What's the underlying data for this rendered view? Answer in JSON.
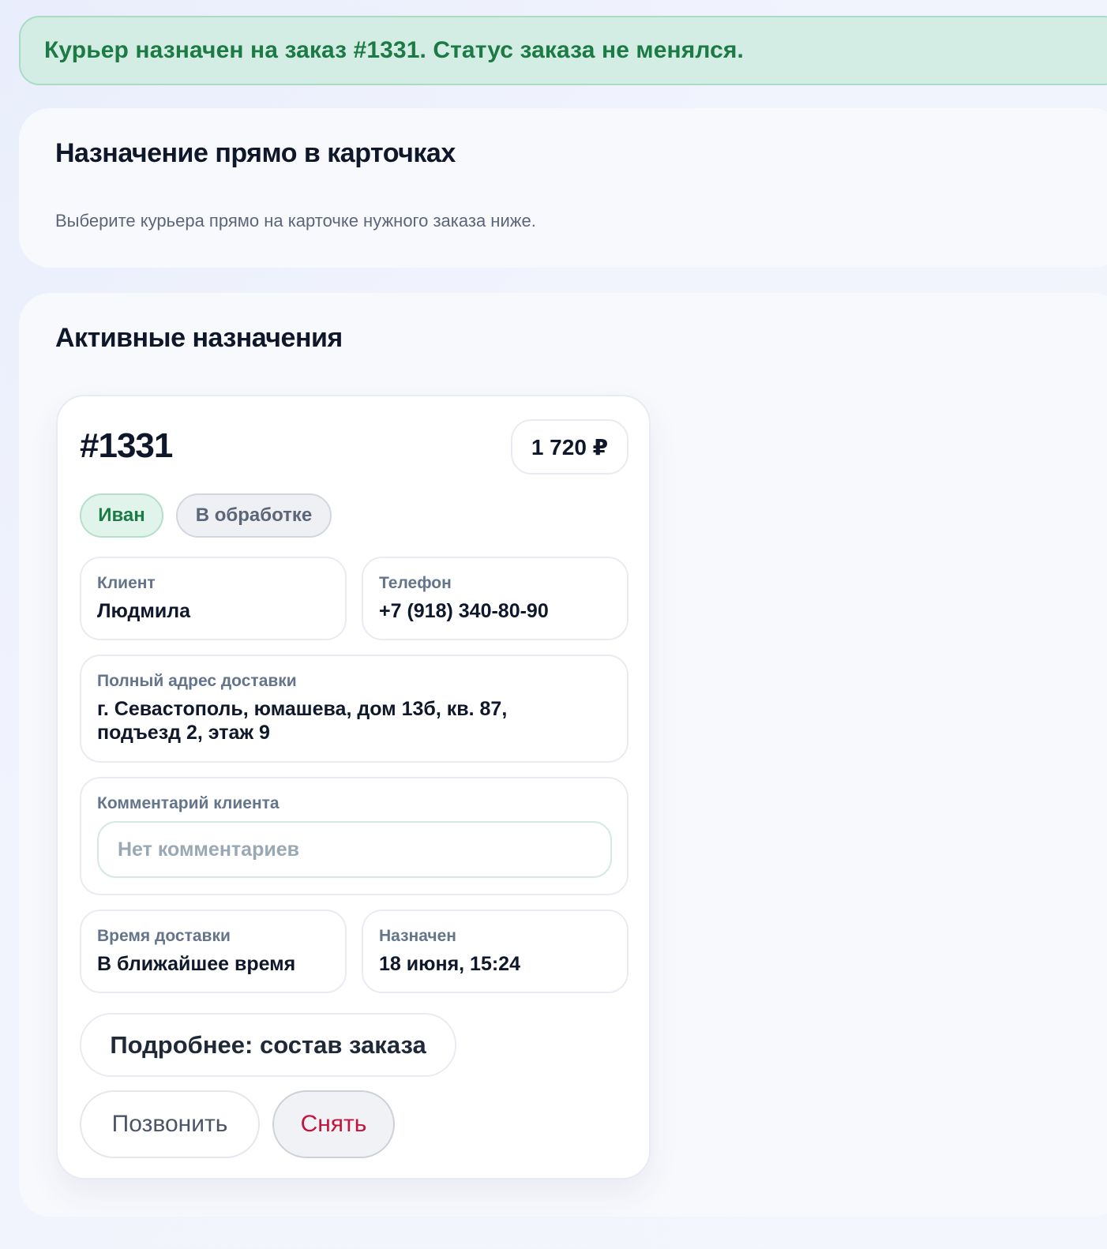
{
  "alert": {
    "message": "Курьер назначен на заказ #1331. Статус заказа не менялся."
  },
  "assign_panel": {
    "title": "Назначение прямо в карточках",
    "subtitle": "Выберите курьера прямо на карточке нужного заказа ниже."
  },
  "active_panel": {
    "title": "Активные назначения"
  },
  "order": {
    "number": "#1331",
    "price": "1 720 ₽",
    "courier_chip": "Иван",
    "status_chip": "В обработке",
    "client": {
      "label": "Клиент",
      "value": "Людмила"
    },
    "phone": {
      "label": "Телефон",
      "value": "+7 (918) 340-80-90"
    },
    "address": {
      "label": "Полный адрес доставки",
      "value": "г. Севастополь, юмашева, дом 13б, кв. 87, подъезд 2, этаж 9"
    },
    "comment": {
      "label": "Комментарий клиента",
      "placeholder": "Нет комментариев"
    },
    "delivery_time": {
      "label": "Время доставки",
      "value": "В ближайшее время"
    },
    "assigned": {
      "label": "Назначен",
      "value": "18 июня, 15:24"
    },
    "details_button": "Подробнее: состав заказа",
    "call_button": "Позвонить",
    "remove_button": "Снять"
  },
  "colors": {
    "success_bg": "#d3ede4",
    "success_text": "#1c7a45",
    "danger_text": "#c4143e",
    "muted_text": "#64748b"
  }
}
